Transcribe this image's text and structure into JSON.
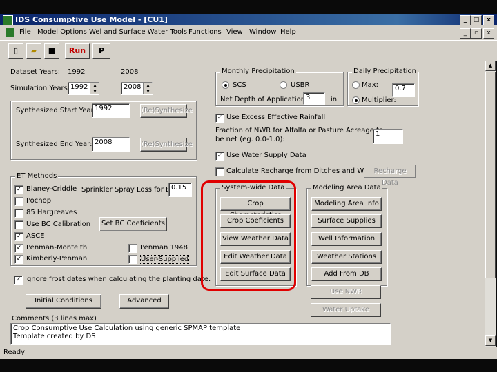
{
  "window": {
    "title": "IDS Consumptive Use Model - [CU1]",
    "min": "_",
    "max": "□",
    "close": "x"
  },
  "menu": [
    "File",
    "Model Options",
    "Wel and Surface Water Tools",
    "Functions",
    "View",
    "Window",
    "Help"
  ],
  "toolbar": {
    "run": "Run",
    "p": "P"
  },
  "dataset": {
    "label": "Dataset Years:",
    "start": "1992",
    "end": "2008"
  },
  "simulation": {
    "label": "Simulation Years:",
    "start": "1992",
    "end": "2008"
  },
  "synth": {
    "start_label": "Synthesized Start Year:",
    "start_value": "1992",
    "resynth1": "(Re)Synthesize",
    "end_label": "Synthesized End Year:",
    "end_value": "2008",
    "resynth2": "(Re)Synthesize"
  },
  "monthly_precip": {
    "title": "Monthly Precipitation",
    "opt1": "SCS",
    "opt2": "USBR",
    "depth_label": "Net Depth of Application:",
    "depth_value": "3",
    "unit": "in"
  },
  "daily_precip": {
    "title": "Daily Precipitation",
    "opt1": "Max:",
    "opt2": "Multiplier:",
    "value": "0.7"
  },
  "excess_rainfall": "Use Excess Effective Rainfall",
  "fraction": {
    "label1": "Fraction of NWR for Alfalfa or Pasture Acreage to",
    "label2": "be net (eg. 0.0-1.0):",
    "value": "1"
  },
  "water_supply": "Use Water Supply Data",
  "recharge": {
    "label": "Calculate Recharge from Ditches and Wells",
    "button": "Recharge Data"
  },
  "et": {
    "title": "ET Methods",
    "methods": [
      "Blaney-Criddle",
      "Pochop",
      "85 Hargreaves",
      "Use BC Calibration",
      "ASCE",
      "Penman-Monteith",
      "Kimberly-Penman"
    ],
    "checked": [
      true,
      false,
      false,
      false,
      true,
      true,
      true
    ],
    "sprinkler_label": "Sprinkler Spray Loss for BC:",
    "sprinkler_value": "0.15",
    "set_bc": "Set BC Coeficients",
    "penman1948": "Penman 1948",
    "user_supplied": "User-Supplied"
  },
  "system_wide": {
    "title": "System-wide Data",
    "buttons": [
      "Crop Characteristics",
      "Crop Coeficients",
      "View Weather Data",
      "Edit Weather Data",
      "Edit Surface Data"
    ]
  },
  "modeling_area": {
    "title": "Modeling Area Data",
    "buttons": [
      "Modeling Area Info",
      "Surface Supplies",
      "Well Information",
      "Weather Stations",
      "Add From DB"
    ],
    "disabled": [
      "Use NWR",
      "Water Uptake"
    ]
  },
  "frost": "Ignore frost dates when calculating the planting date.",
  "initial_conditions": "Initial Conditions",
  "advanced": "Advanced",
  "comments": {
    "label": "Comments (3 lines max)",
    "line1": "Crop Consumptive Use Calculation using generic SPMAP template",
    "line2": "Template created by DS"
  },
  "status": "Ready",
  "colors": {
    "highlight": "#e00000",
    "face": "#d4d0c8",
    "title_bg": "#0a246a"
  }
}
